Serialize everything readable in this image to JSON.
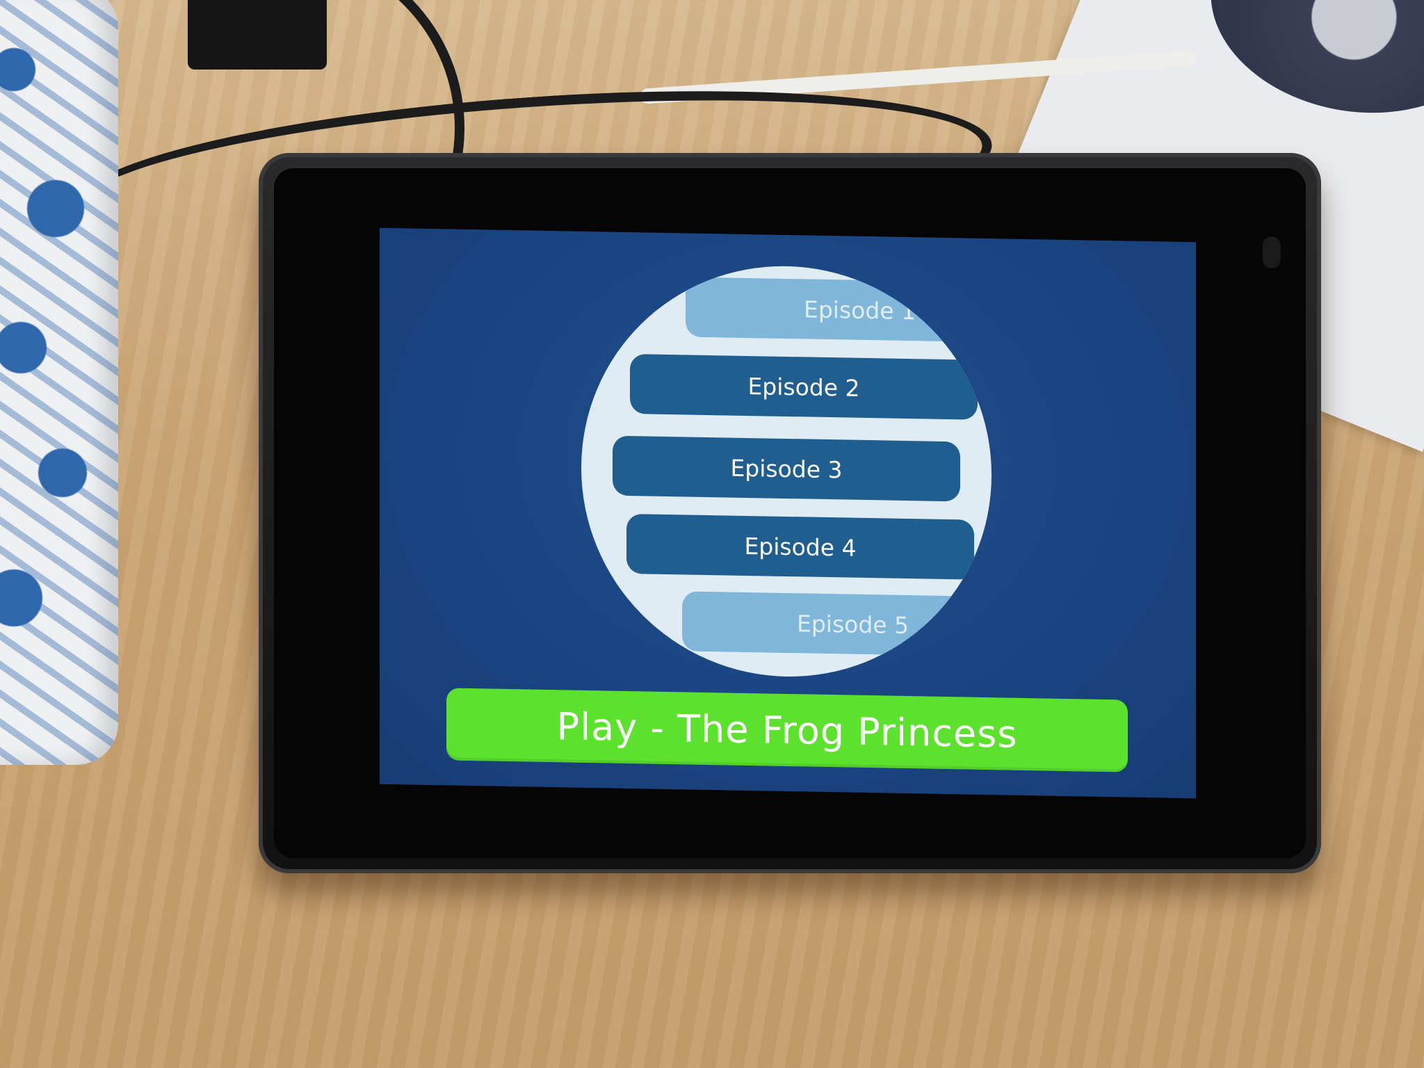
{
  "episode_list": {
    "items": [
      {
        "label": "Episode 1",
        "state": "partially-visible"
      },
      {
        "label": "Episode 2",
        "state": "visible"
      },
      {
        "label": "Episode 3",
        "state": "selected"
      },
      {
        "label": "Episode 4",
        "state": "visible"
      },
      {
        "label": "Episode 5",
        "state": "partially-visible"
      }
    ]
  },
  "play_button": {
    "label": "Play - The Frog Princess",
    "color": "#5ce12d"
  },
  "colors": {
    "screen_background": "#1a4582",
    "wheel_background": "#dfecf3",
    "episode_button": "#1f5e8f",
    "episode_button_faded": "#7fb6d9"
  }
}
